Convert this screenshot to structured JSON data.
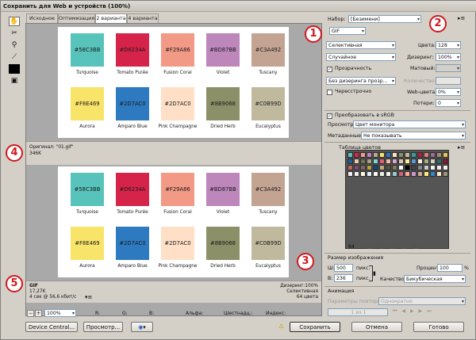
{
  "window": {
    "title": "Сохранить для Web и устройств (100%)"
  },
  "tabs": [
    "Исходное",
    "Оптимизация",
    "2 варианта",
    "4 варианта"
  ],
  "colors": [
    {
      "hex": "#58C3BB",
      "name": "Turquoise"
    },
    {
      "hex": "#D6234A",
      "name": "Tomato Purée"
    },
    {
      "hex": "#F29A86",
      "name": "Fusion Coral"
    },
    {
      "hex": "#BD87BB",
      "name": "Violet"
    },
    {
      "hex": "#C3A492",
      "name": "Tuscany"
    },
    {
      "hex": "#F8E469",
      "name": "Aurora"
    },
    {
      "hex": "#2D7AC0",
      "name": "Amparo Blue"
    },
    {
      "hex": "#FFE0C6",
      "label": "#2D7AC0",
      "name": "Pink Champagne"
    },
    {
      "hex": "#8B9068",
      "name": "Dried Herb"
    },
    {
      "hex": "#C0B99D",
      "name": "Eucalyptus"
    }
  ],
  "top_info": {
    "original": "Оригинал: \"01.gif\"",
    "size": "346K"
  },
  "bottom_info": {
    "format": "GIF",
    "size": "17,27K",
    "time": "4 сек @ 56,6 кбит/с",
    "dither": "Дизеринг:100%",
    "palette": "Селективная",
    "colors_count": "64 цвета"
  },
  "settings": {
    "preset_label": "Набор:",
    "preset_value": "[Безимени]",
    "format": "GIF",
    "reduction": "Селективная",
    "dither_algo": "Случайное",
    "colors_label": "Цвета:",
    "colors_value": "128",
    "dither_label": "Дизеринг:",
    "dither_value": "100%",
    "transparency_label": "Прозрачность",
    "matte_label": "Матовый:",
    "trans_dither": "Без дизеринга прозр...",
    "amount_label": "Количество:",
    "interlaced_label": "Чересстрочно",
    "websnap_label": "Web-цвета:",
    "websnap_value": "0%",
    "lossy_label": "Потери:",
    "lossy_value": "0",
    "srgb_label": "Преобразовать в sRGB",
    "preview_label": "Просмотр:",
    "preview_value": "Цвет монитора",
    "metadata_label": "Метаданные:",
    "metadata_value": "Не показывать",
    "color_table_title": "Таблица цветов",
    "color_count": "64"
  },
  "image_size": {
    "title": "Размер изображения",
    "w_label": "Ш:",
    "w_value": "500",
    "h_label": "В:",
    "h_value": "236",
    "unit": "пикс.",
    "percent_label": "Проценты:",
    "percent_value": "100",
    "percent_sign": "%",
    "quality_label": "Качество:",
    "quality_value": "Бикубическая"
  },
  "animation": {
    "title": "Анимация",
    "loop_label": "Параметры повторов:",
    "loop_value": "Однократно",
    "frame_counter": "1 из 1"
  },
  "statusbar": {
    "zoom": "100%",
    "r": "R:",
    "g": "G:",
    "b": "B:",
    "alpha": "Альфа:",
    "hex": "Шестнадц.:",
    "index": "Индекс:"
  },
  "buttons": {
    "device_central": "Device Central...",
    "preview": "Просмотр...",
    "save": "Сохранить",
    "cancel": "Отмена",
    "done": "Готово"
  },
  "markers": [
    "1",
    "2",
    "3",
    "4",
    "5"
  ],
  "palette_colors": [
    "#58c3bb",
    "#d6234a",
    "#f29a86",
    "#bd87bb",
    "#c3a492",
    "#f8e469",
    "#2d7ac0",
    "#ffe0c6",
    "#8b9068",
    "#c0b99d",
    "#3a9e97",
    "#b01e3e",
    "#e08070",
    "#9a6a98",
    "#a88878",
    "#e0c850",
    "#1f5e98",
    "#f0c8a8",
    "#6e7450",
    "#a8a080",
    "#7fd6cf",
    "#e85a72",
    "#f7b8a8",
    "#d4a8d2",
    "#dcc4b6",
    "#fcee96",
    "#5a9ad6",
    "#fff0e0",
    "#a8ae88",
    "#d8d2bc",
    "#2e6a66",
    "#8a1530",
    "#b86858",
    "#7a4e78",
    "#806858",
    "#b8a040",
    "#164876",
    "#c8a888",
    "#50563a",
    "#807a60",
    "#ffffff",
    "#000000",
    "#444444",
    "#888888",
    "#cccccc",
    "#e8f6f4",
    "#fae6ea",
    "#fdf0ec",
    "#f4ecf4",
    "#f4eee8",
    "#fefae6",
    "#e6f0f8",
    "#fff8f0",
    "#eef0e6",
    "#f4f2ec",
    "#99cccc",
    "#cc6677",
    "#ffaa99",
    "#cc99cc",
    "#ccaa99",
    "#ffee77",
    "#3388cc",
    "#ffe8cc",
    "#999977"
  ]
}
